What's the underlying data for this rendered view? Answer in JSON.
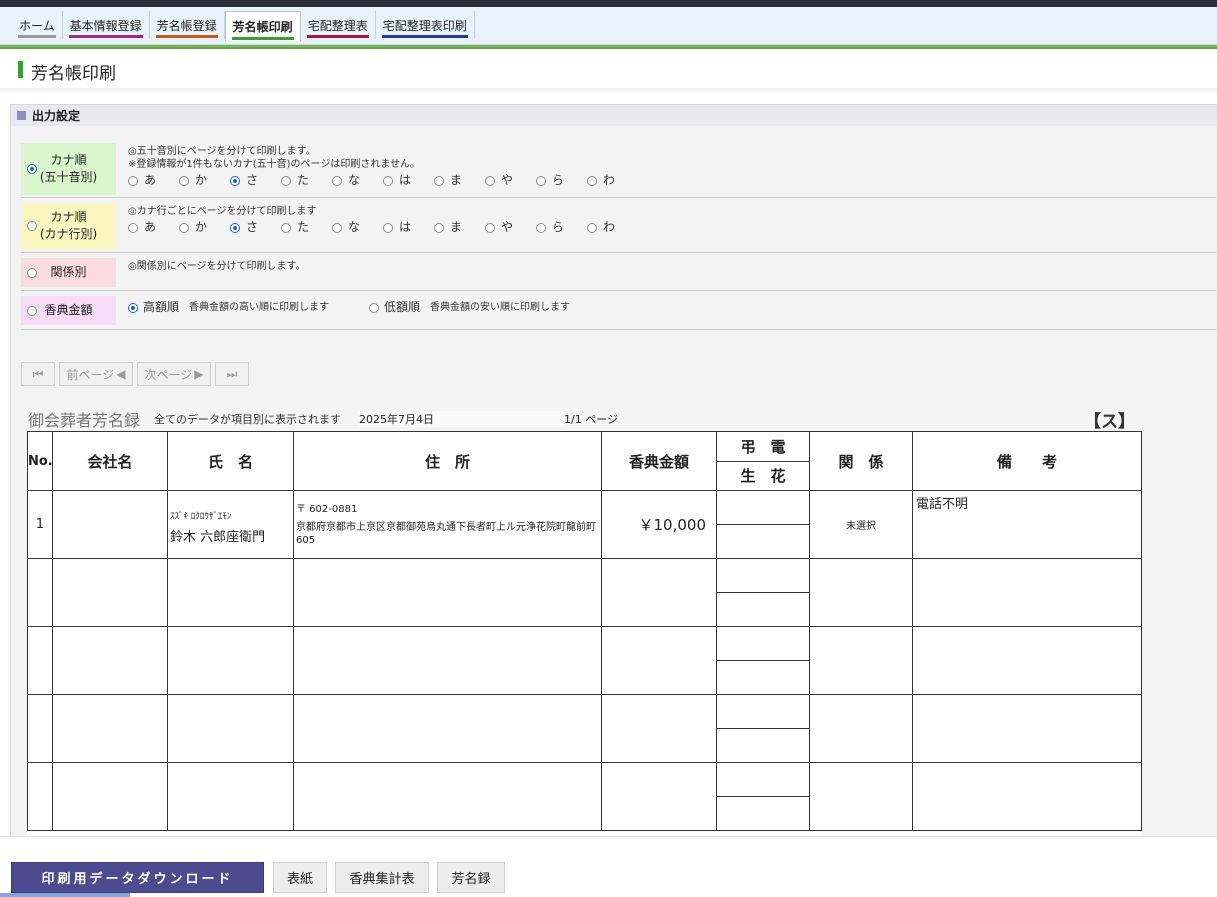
{
  "nav": {
    "tabs": [
      {
        "label": "ホーム",
        "color": "#9a9a9a"
      },
      {
        "label": "基本情報登録",
        "color": "#9a2b7e"
      },
      {
        "label": "芳名帳登録",
        "color": "#c25a1a"
      },
      {
        "label": "芳名帳印刷",
        "color": "#3d9b3a"
      },
      {
        "label": "宅配整理表",
        "color": "#a01a3a"
      },
      {
        "label": "宅配整理表印刷",
        "color": "#243a8a"
      }
    ]
  },
  "page_title": "芳名帳印刷",
  "section_title": "出力設定",
  "options": {
    "kana50": {
      "label1": "カナ順",
      "label2": "(五十音別)",
      "note1": "◎五十音別にページを分けて印刷します。",
      "note2": "※登録情報が1件もないカナ(五十音)のページは印刷されません。"
    },
    "kanarow": {
      "label1": "カナ順",
      "label2": "(カナ行別)",
      "note1": "◎カナ行ごとにページを分けて印刷します"
    },
    "relation": {
      "label1": "関係別",
      "note1": "◎関係別にページを分けて印刷します。"
    },
    "amount": {
      "label1": "香典金額",
      "high_label": "高額順",
      "high_note": "香典金額の高い順に印刷します",
      "low_label": "低額順",
      "low_note": "香典金額の安い順に印刷します"
    },
    "kana_letters": [
      "あ",
      "か",
      "さ",
      "た",
      "な",
      "は",
      "ま",
      "や",
      "ら",
      "わ"
    ]
  },
  "pager": {
    "first_symbol": "⏮",
    "prev_label": "前ページ",
    "next_label": "次ページ",
    "last_symbol": "⏭"
  },
  "sheet": {
    "title": "御会葬者芳名録",
    "note": "全てのデータが項目別に表示されます",
    "date": "2025年7月4日",
    "page": "1/1 ページ",
    "letter": "【ス】",
    "headers": {
      "no": "No.",
      "company": "会社名",
      "name": "氏　名",
      "address": "住　所",
      "amount": "香典金額",
      "telegram": "弔　電",
      "flower": "生　花",
      "relation": "関　係",
      "remarks": "備　　考"
    },
    "rows": [
      {
        "no": "1",
        "company": "",
        "kana": "ｽｽﾞｷ ﾛｸﾛｳｻﾞｴﾓﾝ",
        "name": "鈴木 六郎座衛門",
        "postal": "〒 602-0881",
        "address": "京都府京都市上京区京都御苑烏丸通下長者町上ル元浄花院町龍前町605",
        "amount": "￥10,000",
        "relation": "未選択",
        "remarks": "電話不明"
      }
    ]
  },
  "bottom": {
    "download_label": "印刷用データダウンロード",
    "cover_label": "表紙",
    "summary_label": "香典集計表",
    "register_label": "芳名録"
  }
}
